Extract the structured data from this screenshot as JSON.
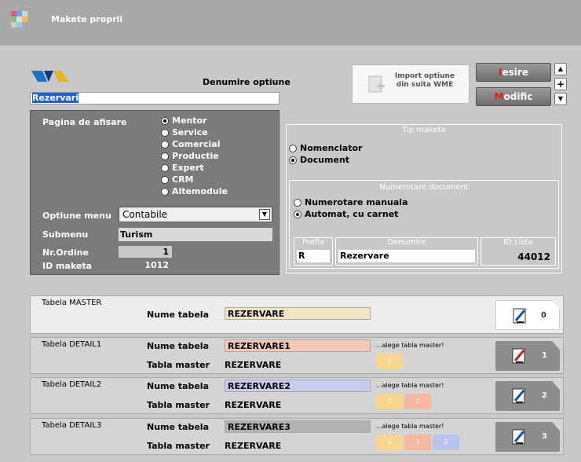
{
  "window": {
    "title": "Makete proprii"
  },
  "header": {
    "denumire_label": "Denumire optiune",
    "denumire_value": "Rezervari",
    "import_label": "Import optiune din suita WME",
    "iesire_first": "I",
    "iesire_rest": "esire",
    "modific_first": "M",
    "modific_rest": "odific",
    "scroll_up": "▲",
    "scroll_plus": "+",
    "scroll_down": "▼"
  },
  "left": {
    "pagina_label": "Pagina de afisare",
    "modules": [
      "Mentor",
      "Service",
      "Comercial",
      "Productie",
      "Expert",
      "CRM",
      "Altemodule"
    ],
    "selected_module": 0,
    "optiune_label": "Optiune menu",
    "optiune_value": "Contabile",
    "submenu_label": "Submenu",
    "submenu_value": "Turism",
    "nrordine_label": "Nr.Ordine",
    "nrordine_value": "1",
    "idmacheta_label": "ID maketa",
    "idmacheta_value": "1012"
  },
  "tip": {
    "title": "Tip maketa",
    "options": [
      "Nomenclator",
      "Document"
    ],
    "selected": 1,
    "num_title": "Numerotare document",
    "num_options": [
      "Numerotare manuala",
      "Automat, cu carnet"
    ],
    "num_selected": 1,
    "prefix_label": "Prefix",
    "prefix_value": "R",
    "denumire_label": "Denumire",
    "denumire_value": "Rezervare",
    "idlista_label": "ID Lista",
    "idlista_value": "44012"
  },
  "tables": {
    "nume_tabela_label": "Nume tabela",
    "tabla_master_label": "Tabla master",
    "hint": "...alege tabla master!",
    "master": {
      "title": "Tabela MASTER",
      "name": "REZERVARE",
      "num": "0"
    },
    "d1": {
      "title": "Tabela DETAIL1",
      "name": "REZERVARE1",
      "master": "REZERVARE",
      "num": "1",
      "chips": [
        "0"
      ]
    },
    "d2": {
      "title": "Tabela DETAIL2",
      "name": "REZERVARE2",
      "master": "REZERVARE",
      "num": "2",
      "chips": [
        "0",
        "1"
      ]
    },
    "d3": {
      "title": "Tabela DETAIL3",
      "name": "REZERVARE3",
      "master": "REZERVARE",
      "num": "3",
      "chips": [
        "0",
        "1",
        "2"
      ]
    }
  },
  "colors": {
    "master_field": "#f3e5c4",
    "d1_field": "#f4c7b6",
    "d2_field": "#c9cbee",
    "d3_field": "#b2b2b2",
    "chip0": "#f6d68a",
    "chip1": "#f5b8a3",
    "chip2": "#b8c4ee"
  }
}
